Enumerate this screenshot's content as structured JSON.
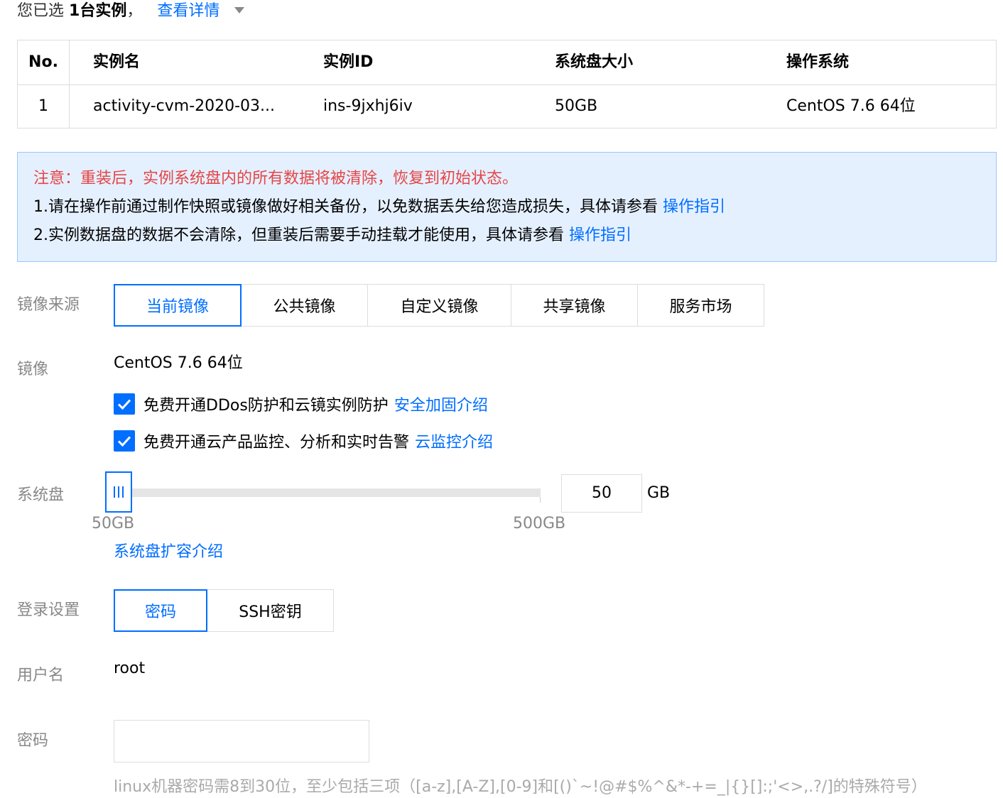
{
  "selection": {
    "prefix": "您已选",
    "count": "1台实例",
    "suffix": "，",
    "details_link": "查看详情"
  },
  "instance_table": {
    "columns": [
      "No.",
      "实例名",
      "实例ID",
      "系统盘大小",
      "操作系统"
    ],
    "rows": [
      [
        "1",
        "activity-cvm-2020-03...",
        "ins-9jxhj6iv",
        "50GB",
        "CentOS 7.6 64位"
      ]
    ]
  },
  "notice": {
    "warning": "注意：重装后，实例系统盘内的所有数据将被清除，恢复到初始状态。",
    "item1_text": "1.请在操作前通过制作快照或镜像做好相关备份，以免数据丢失给您造成损失，具体请参看",
    "item1_link": "操作指引",
    "item2_text": "2.实例数据盘的数据不会清除，但重装后需要手动挂载才能使用，具体请参看",
    "item2_link": "操作指引"
  },
  "image_source": {
    "label": "镜像来源",
    "options": [
      "当前镜像",
      "公共镜像",
      "自定义镜像",
      "共享镜像",
      "服务市场"
    ],
    "selected": "当前镜像"
  },
  "image": {
    "label": "镜像",
    "value": "CentOS 7.6 64位"
  },
  "options": {
    "ddos_text": "免费开通DDos防护和云镜实例防护",
    "ddos_link": "安全加固介绍",
    "ddos_checked": true,
    "monitor_text": "免费开通云产品监控、分析和实时告警",
    "monitor_link": "云监控介绍",
    "monitor_checked": true
  },
  "system_disk": {
    "label": "系统盘",
    "min_label": "50GB",
    "max_label": "500GB",
    "min": 50,
    "max": 500,
    "value": "50",
    "unit": "GB",
    "expand_link": "系统盘扩容介绍"
  },
  "login": {
    "label": "登录设置",
    "options": [
      "密码",
      "SSH密钥"
    ],
    "selected": "密码"
  },
  "username": {
    "label": "用户名",
    "value": "root"
  },
  "password": {
    "label": "密码",
    "value": "",
    "hint": "linux机器密码需8到30位，至少包括三项（[a-z],[A-Z],[0-9]和[()`~!@#$%^&*-+=_|{}[]:;'<>,.?/]的特殊符号）"
  },
  "colors": {
    "accent": "#006eff",
    "warning": "#e54545",
    "notice_bg": "#e5f0ff",
    "notice_border": "#97c7ff",
    "label": "#888888",
    "border": "#dddddd"
  }
}
